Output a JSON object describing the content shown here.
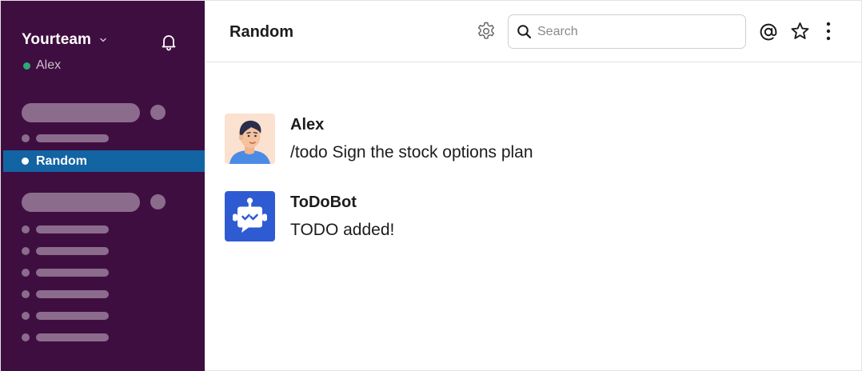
{
  "sidebar": {
    "team_name": "Yourteam",
    "user_name": "Alex",
    "presence_color": "#2bac76",
    "background_color": "#3f0e40",
    "active_channel": "Random",
    "icons": {
      "team_menu": "chevron-down-icon",
      "notifications": "bell-icon"
    }
  },
  "header": {
    "channel_title": "Random",
    "search": {
      "placeholder": "Search",
      "value": ""
    },
    "icons": [
      "gear-icon",
      "search-icon",
      "at-mention-icon",
      "star-icon",
      "more-vertical-icon"
    ]
  },
  "messages": [
    {
      "author": "Alex",
      "text": "/todo Sign the stock options plan",
      "avatar_icon": "user-avatar-icon"
    },
    {
      "author": "ToDoBot",
      "text": "TODO added!",
      "avatar_icon": "bot-avatar-icon"
    }
  ],
  "colors": {
    "active_item": "#1264a3",
    "bot_avatar": "#2f5bd2"
  }
}
